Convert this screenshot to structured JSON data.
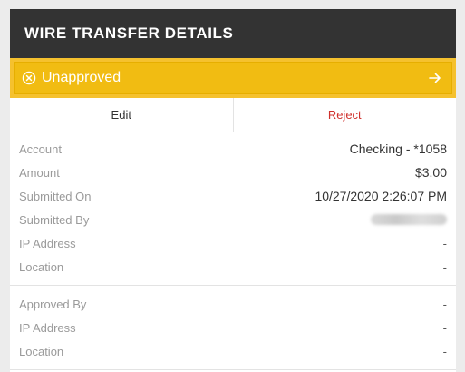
{
  "header": {
    "title": "WIRE TRANSFER DETAILS"
  },
  "status": {
    "label": "Unapproved",
    "icon": "x-circle-icon",
    "action_icon": "arrow-right-icon",
    "color": "#f1bc12"
  },
  "actions": {
    "edit_label": "Edit",
    "reject_label": "Reject",
    "reject_color": "#d0312d"
  },
  "details": [
    {
      "label": "Account",
      "value": "Checking - *1058"
    },
    {
      "label": "Amount",
      "value": "$3.00"
    },
    {
      "label": "Submitted On",
      "value": "10/27/2020 2:26:07 PM"
    },
    {
      "label": "Submitted By",
      "value": ""
    },
    {
      "label": "IP Address",
      "value": "-"
    },
    {
      "label": "Location",
      "value": "-"
    }
  ],
  "approval": [
    {
      "label": "Approved By",
      "value": "-"
    },
    {
      "label": "IP Address",
      "value": "-"
    },
    {
      "label": "Location",
      "value": "-"
    }
  ]
}
